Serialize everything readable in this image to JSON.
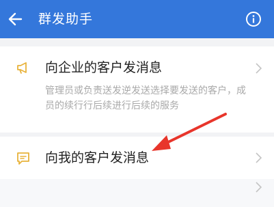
{
  "appbar": {
    "title": "群发助手",
    "back_icon": "back-arrow-icon",
    "info_icon": "info-icon",
    "color": "#3477db"
  },
  "items": [
    {
      "title": "向企业的客户发消息",
      "description": "管理员或负责送发逆发送选择要发送的客户，成员的续行行后续进行后续的服务",
      "icon": "megaphone-icon"
    },
    {
      "title": "向我的客户发消息",
      "icon": "message-icon"
    }
  ],
  "colors": {
    "accent": "#e8b23a",
    "annotation": "#e8352b"
  }
}
